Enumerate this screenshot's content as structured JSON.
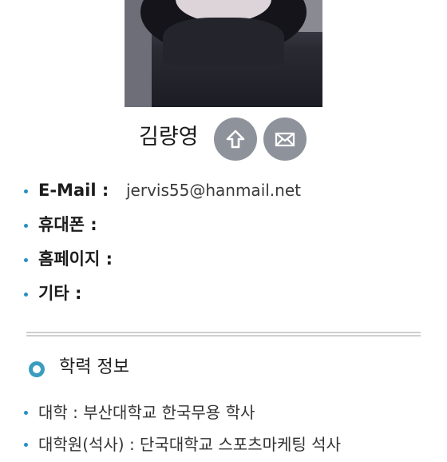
{
  "profile": {
    "name": "김량영",
    "buttons": {
      "top_icon": "up-arrow-icon",
      "mail_icon": "envelope-icon"
    }
  },
  "info": [
    {
      "label": "E-Mail :",
      "value": "jervis55@hanmail.net"
    },
    {
      "label": "휴대폰 :",
      "value": ""
    },
    {
      "label": "홈페이지 :",
      "value": ""
    },
    {
      "label": "기타 :",
      "value": ""
    }
  ],
  "education": {
    "title": "학력 정보",
    "items": [
      "대학 : 부산대학교 한국무용 학사",
      "대학원(석사) : 단국대학교 스포츠마케팅 석사"
    ]
  },
  "colors": {
    "accent": "#2a8fc3",
    "button_gray": "#8e939b"
  }
}
